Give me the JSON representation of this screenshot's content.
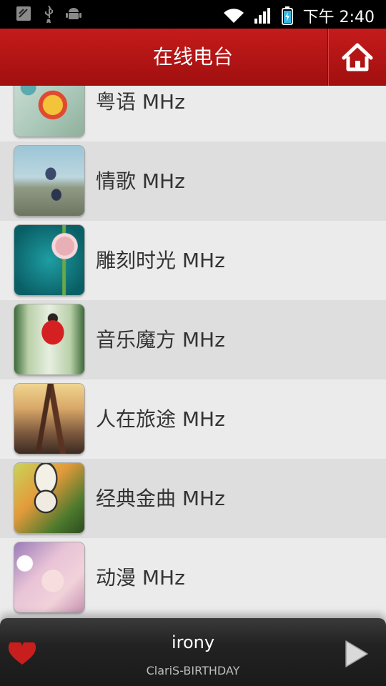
{
  "status_bar": {
    "time": "下午 2:40",
    "icons": [
      "phone-signal-icon",
      "usb-icon",
      "android-icon",
      "wifi-icon",
      "cell-signal-icon",
      "battery-icon"
    ]
  },
  "header": {
    "title": "在线电台",
    "home_icon": "home-icon",
    "accent": "#b41515"
  },
  "stations": [
    {
      "label": "粤语 MHz"
    },
    {
      "label": "情歌 MHz"
    },
    {
      "label": "雕刻时光 MHz"
    },
    {
      "label": "音乐魔方 MHz"
    },
    {
      "label": "人在旅途 MHz"
    },
    {
      "label": "经典金曲 MHz"
    },
    {
      "label": "动漫 MHz"
    }
  ],
  "player": {
    "song": "irony",
    "artist": "ClariS-BIRTHDAY",
    "favorite_icon": "heart-icon",
    "play_icon": "play-icon",
    "heart_color": "#c81e1e"
  }
}
